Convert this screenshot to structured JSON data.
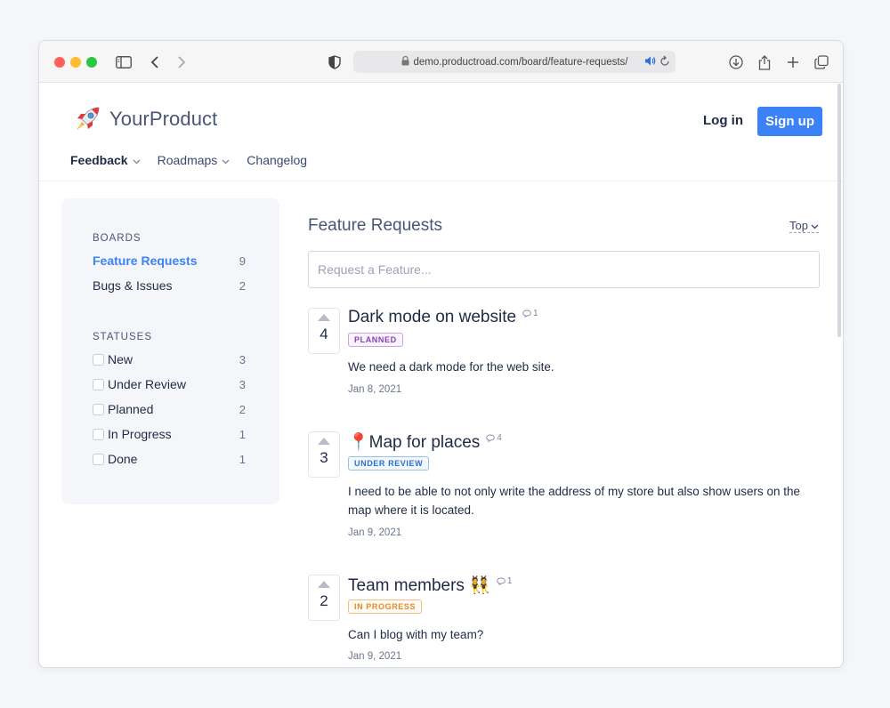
{
  "browser": {
    "url": "demo.productroad.com/board/feature-requests/"
  },
  "site": {
    "brand": "YourProduct",
    "login_label": "Log in",
    "signup_label": "Sign up",
    "nav": [
      {
        "label": "Feedback"
      },
      {
        "label": "Roadmaps"
      },
      {
        "label": "Changelog"
      }
    ]
  },
  "sidebar": {
    "boards_title": "BOARDS",
    "boards": [
      {
        "label": "Feature Requests",
        "count": "9"
      },
      {
        "label": "Bugs & Issues",
        "count": "2"
      }
    ],
    "statuses_title": "STATUSES",
    "statuses": [
      {
        "label": "New",
        "count": "3"
      },
      {
        "label": "Under Review",
        "count": "3"
      },
      {
        "label": "Planned",
        "count": "2"
      },
      {
        "label": "In Progress",
        "count": "1"
      },
      {
        "label": "Done",
        "count": "1"
      }
    ]
  },
  "main": {
    "title": "Feature Requests",
    "sort_label": "Top",
    "request_placeholder": "Request a Feature...",
    "posts": [
      {
        "votes": "4",
        "title": "Dark mode on website",
        "comments": "1",
        "status": "PLANNED",
        "body": "We need a dark mode for the web site.",
        "date": "Jan 8, 2021"
      },
      {
        "votes": "3",
        "title": "📍Map for places",
        "comments": "4",
        "status": "UNDER REVIEW",
        "body": "I need to be able to not only write the address of my store but also show users on the map where it is located.",
        "date": "Jan 9, 2021"
      },
      {
        "votes": "2",
        "title": "Team members 👯",
        "comments": "1",
        "status": "IN PROGRESS",
        "body": "Can I blog with my team?",
        "date": "Jan 9, 2021"
      }
    ]
  },
  "colors": {
    "accent": "#3b82f6",
    "planned": "#8b3fb5",
    "under_review": "#2870c9",
    "in_progress": "#e08a2c"
  }
}
